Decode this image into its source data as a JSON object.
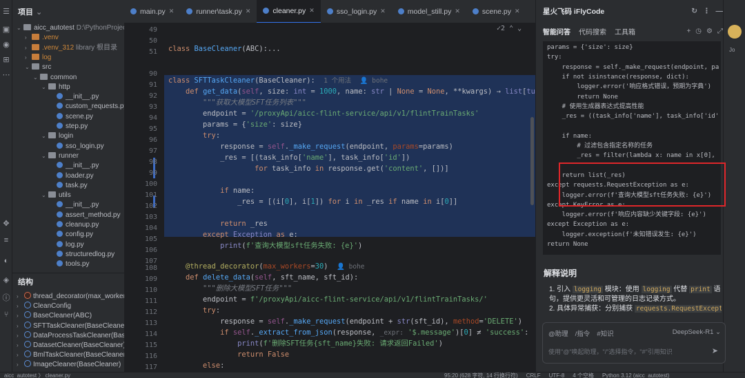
{
  "tabs": [
    {
      "label": "main.py",
      "active": false
    },
    {
      "label": "runner\\task.py",
      "active": false
    },
    {
      "label": "cleaner.py",
      "active": true
    },
    {
      "label": "sso_login.py",
      "active": false
    },
    {
      "label": "model_still.py",
      "active": false
    },
    {
      "label": "scene.py",
      "active": false
    }
  ],
  "project": {
    "title": "项目",
    "rows": [
      {
        "text": "aicc_autotest",
        "extra": "D:\\PythonProject",
        "indent": 0,
        "kind": "folder"
      },
      {
        "text": ".venv",
        "extra": "",
        "indent": 1,
        "kind": "folder-orange"
      },
      {
        "text": ".venv_312",
        "extra": "library 根目录",
        "indent": 1,
        "kind": "folder-orange"
      },
      {
        "text": "log",
        "extra": "",
        "indent": 1,
        "kind": "folder-orange"
      },
      {
        "text": "src",
        "extra": "",
        "indent": 1,
        "kind": "folder"
      },
      {
        "text": "common",
        "extra": "",
        "indent": 2,
        "kind": "folder"
      },
      {
        "text": "http",
        "extra": "",
        "indent": 3,
        "kind": "folder"
      },
      {
        "text": "__init__.py",
        "extra": "",
        "indent": 4,
        "kind": "py"
      },
      {
        "text": "custom_requests.py",
        "extra": "",
        "indent": 4,
        "kind": "py"
      },
      {
        "text": "scene.py",
        "extra": "",
        "indent": 4,
        "kind": "py"
      },
      {
        "text": "step.py",
        "extra": "",
        "indent": 4,
        "kind": "py"
      },
      {
        "text": "login",
        "extra": "",
        "indent": 3,
        "kind": "folder"
      },
      {
        "text": "sso_login.py",
        "extra": "",
        "indent": 4,
        "kind": "py"
      },
      {
        "text": "runner",
        "extra": "",
        "indent": 3,
        "kind": "folder"
      },
      {
        "text": "__init__.py",
        "extra": "",
        "indent": 4,
        "kind": "py"
      },
      {
        "text": "loader.py",
        "extra": "",
        "indent": 4,
        "kind": "py"
      },
      {
        "text": "task.py",
        "extra": "",
        "indent": 4,
        "kind": "py"
      },
      {
        "text": "utils",
        "extra": "",
        "indent": 3,
        "kind": "folder"
      },
      {
        "text": "__init__.py",
        "extra": "",
        "indent": 4,
        "kind": "py"
      },
      {
        "text": "assert_method.py",
        "extra": "",
        "indent": 4,
        "kind": "py"
      },
      {
        "text": "cleanup.py",
        "extra": "",
        "indent": 4,
        "kind": "py"
      },
      {
        "text": "config.py",
        "extra": "",
        "indent": 4,
        "kind": "py"
      },
      {
        "text": "log.py",
        "extra": "",
        "indent": 4,
        "kind": "py"
      },
      {
        "text": "structuredlog.py",
        "extra": "",
        "indent": 4,
        "kind": "py"
      },
      {
        "text": "tools.py",
        "extra": "",
        "indent": 4,
        "kind": "py"
      }
    ]
  },
  "structure": {
    "title": "结构",
    "rows": [
      {
        "text": "thread_decorator(max_workers",
        "kind": "f"
      },
      {
        "text": "CleanConfig",
        "kind": "c"
      },
      {
        "text": "BaseCleaner(ABC)",
        "kind": "c"
      },
      {
        "text": "SFTTaskCleaner(BaseCleaner)",
        "kind": "c"
      },
      {
        "text": "DataProcessTaskCleaner(BaseC",
        "kind": "c"
      },
      {
        "text": "DatasetCleaner(BaseCleaner)",
        "kind": "c"
      },
      {
        "text": "BmlTaskCleaner(BaseCleaner)",
        "kind": "c"
      },
      {
        "text": "ImageCleaner(BaseCleaner)",
        "kind": "c"
      }
    ]
  },
  "editor": {
    "line_numbers": [
      "49",
      "50",
      "51",
      "90",
      "91",
      "92",
      "93",
      "94",
      "95",
      "96",
      "97",
      "98",
      "99",
      "100",
      "101",
      "102",
      "103",
      "104",
      "105",
      "106",
      "107",
      "108",
      "109",
      "110",
      "111",
      "112",
      "113",
      "114",
      "115",
      "116",
      "117"
    ],
    "indicator": "2",
    "usage_hint": "1 个用法",
    "author": "bohe",
    "author2": "bohe"
  },
  "right": {
    "title": "星火飞码 iFlyCode",
    "tabs": [
      "智能问答",
      "代码搜索",
      "工具箱"
    ],
    "code_lines": [
      "params = {'size': size}",
      "try:",
      "    response = self._make_request(endpoint, pa",
      "    if not isinstance(response, dict):",
      "        logger.error('响应格式错误，预期为字典')",
      "        return None",
      "    # 使用生成器表达式提高性能",
      "    _res = ((task_info['name'], task_info['id'",
      "",
      "    if name:",
      "        # 过滤包含指定名称的任务",
      "        _res = filter(lambda x: name in x[0],",
      "",
      "    return list(_res)",
      "except requests.RequestException as e:",
      "    logger.error(f'查询大模型sft任务失败: {e}')",
      "except KeyError as e:",
      "    logger.error(f'响应内容缺少关键字段: {e}')",
      "except Exception as e:",
      "    logger.exception(f'未知错误发生: {e}')",
      "return None"
    ],
    "explain_title": "解释说明",
    "explain_1_a": "1. 引入",
    "explain_1_chip": "logging",
    "explain_1_b": "模块：使用",
    "explain_1_chip2": "logging",
    "explain_1_c": "代替",
    "explain_1_chip3": "print",
    "explain_1_d": "语句，提供更灵活和可管理的日志记录方式。",
    "explain_2_a": "2. 具体异常捕获：分别捕获",
    "explain_2_chip": "requests.RequestExceptio",
    "input_tags": [
      "@助理",
      "/指令",
      "#知识"
    ],
    "model": "DeepSeek-R1",
    "placeholder": "使用\"@\"唤起助理，\"/\"选择指令，\"#\"引用知识",
    "side_label": "Jo"
  },
  "status": {
    "left": "aicc_autotest 〉 cleaner.py",
    "items": [
      "95:20 (628 字符, 14 行换行符)",
      "CRLF",
      "UTF-8",
      "4 个空格",
      "Python 3.12 (aicc_autotest)"
    ]
  },
  "colors": {
    "accent": "#3574f0",
    "selection": "#214283",
    "highlight_box": "#e0262a"
  }
}
